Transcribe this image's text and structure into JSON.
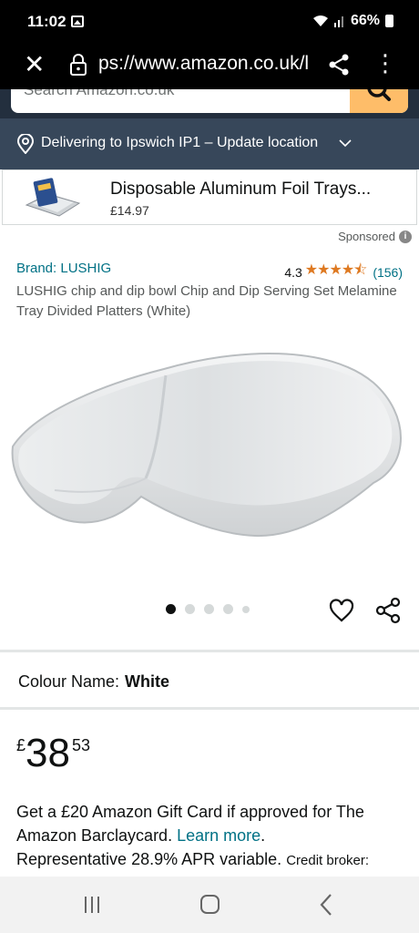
{
  "status_bar": {
    "time": "11:02",
    "battery": "66%"
  },
  "browser": {
    "url": "ps://www.amazon.co.uk/l"
  },
  "search": {
    "placeholder": "Search Amazon.co.uk"
  },
  "delivery": {
    "text": "Delivering to Ipswich IP1 – Update location"
  },
  "sponsored_ad": {
    "title": "Disposable Aluminum Foil Trays...",
    "price": "£14.97",
    "sponsored_label": "Sponsored"
  },
  "product": {
    "brand": "Brand: LUSHIG",
    "rating": "4.3",
    "stars_display": "★★★★⯪",
    "review_count": "(156)",
    "title": "LUSHIG chip and dip bowl Chip and Dip Serving Set Melamine Tray Divided Platters (White)",
    "image_count": 5,
    "active_image": 1,
    "colour_label": "Colour Name:",
    "colour_value": "White",
    "price_symbol": "£",
    "price_whole": "38",
    "price_fraction": "53",
    "promo_text": "Get a £20 Amazon Gift Card if approved for The Amazon Barclaycard.",
    "promo_link": "Learn more",
    "promo_end": ".",
    "apr_text": "Representative 28.9% APR variable.",
    "broker_text": "Credit broker:"
  },
  "colors": {
    "header": "#232f3e",
    "delivery_bar": "#37475a",
    "search_button": "#febd69",
    "link": "#007185",
    "star": "#de7921"
  }
}
